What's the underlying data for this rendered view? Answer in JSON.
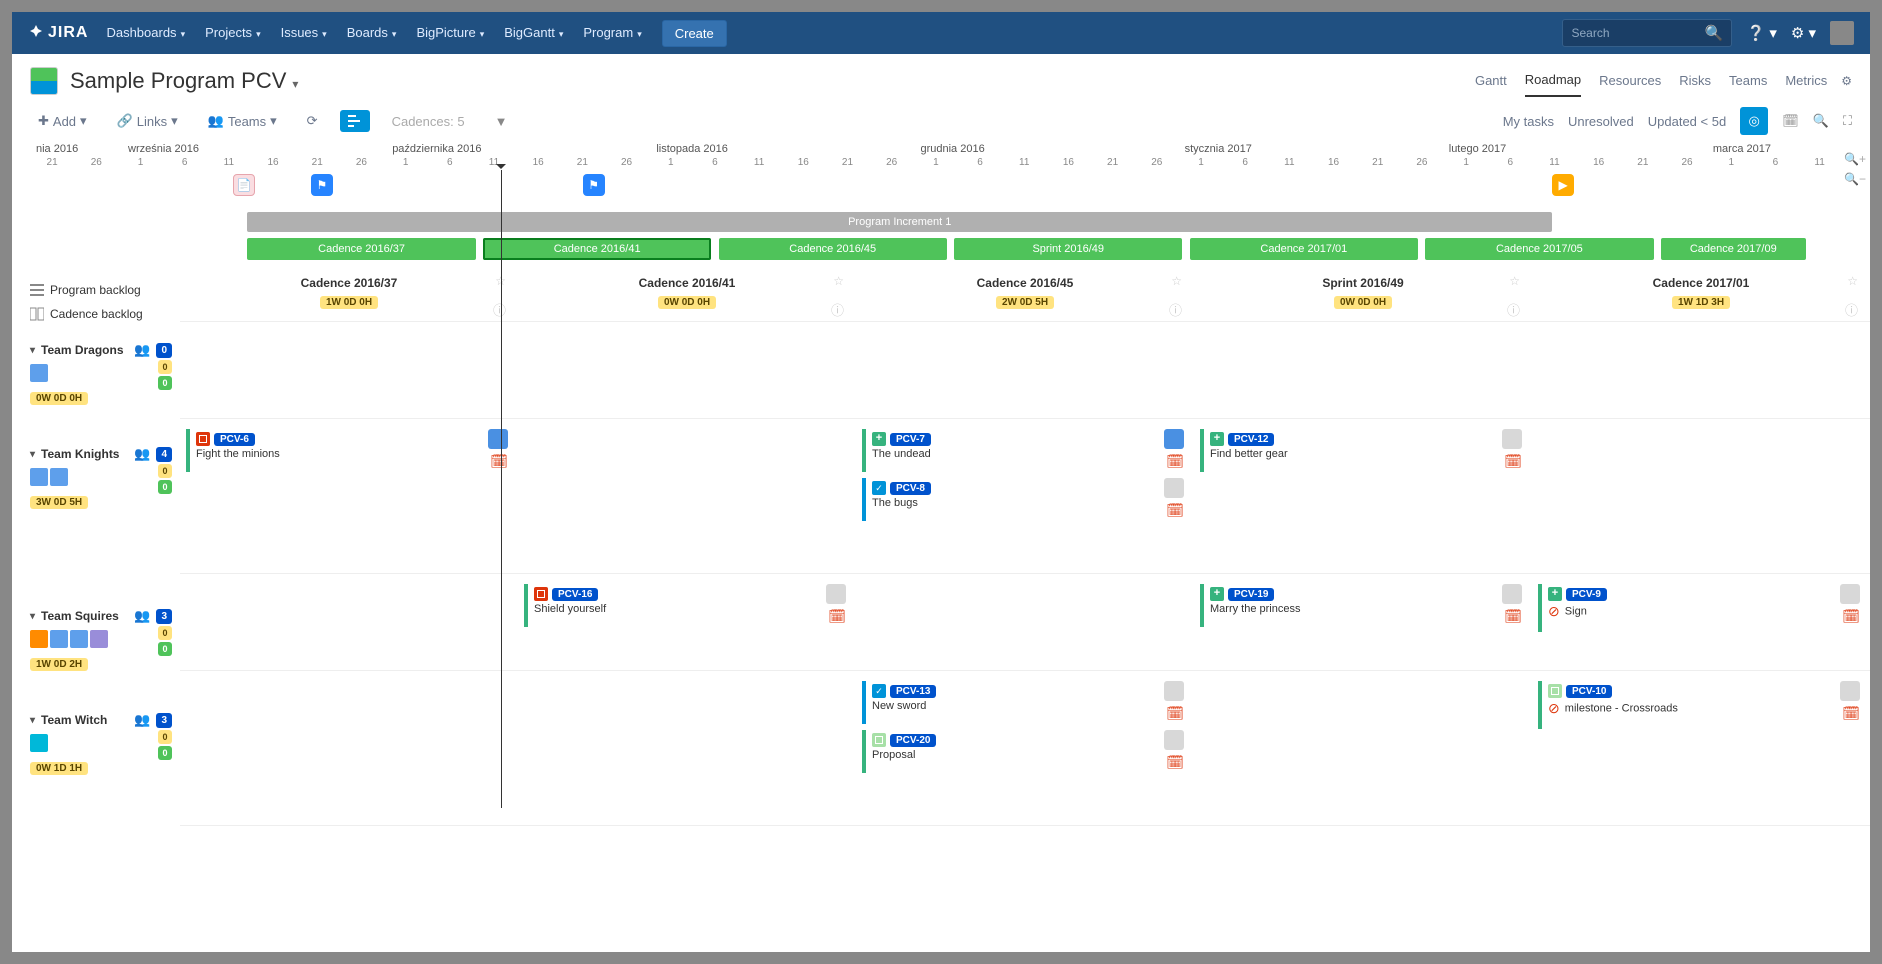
{
  "topnav": {
    "logo": "JIRA",
    "menu": [
      "Dashboards",
      "Projects",
      "Issues",
      "Boards",
      "BigPicture",
      "BigGantt",
      "Program"
    ],
    "create": "Create",
    "search_placeholder": "Search"
  },
  "header": {
    "title": "Sample Program PCV",
    "tabs": [
      "Gantt",
      "Roadmap",
      "Resources",
      "Risks",
      "Teams",
      "Metrics"
    ],
    "active_tab": "Roadmap"
  },
  "toolbar": {
    "add": "Add",
    "links": "Links",
    "teams": "Teams",
    "cadences": "Cadences: 5",
    "filters": [
      "My tasks",
      "Unresolved",
      "Updated < 5d"
    ]
  },
  "timeline": {
    "months": [
      {
        "label": "nia 2016",
        "days": [
          "21",
          "26"
        ]
      },
      {
        "label": "września 2016",
        "days": [
          "1",
          "6",
          "11",
          "16",
          "21",
          "26"
        ]
      },
      {
        "label": "października 2016",
        "days": [
          "1",
          "6",
          "11",
          "16",
          "21",
          "26"
        ]
      },
      {
        "label": "listopada 2016",
        "days": [
          "1",
          "6",
          "11",
          "16",
          "21",
          "26"
        ]
      },
      {
        "label": "grudnia 2016",
        "days": [
          "1",
          "6",
          "11",
          "16",
          "21",
          "26"
        ]
      },
      {
        "label": "stycznia 2017",
        "days": [
          "1",
          "6",
          "11",
          "16",
          "21",
          "26"
        ]
      },
      {
        "label": "lutego 2017",
        "days": [
          "1",
          "6",
          "11",
          "16",
          "21",
          "26"
        ]
      },
      {
        "label": "marca 2017",
        "days": [
          "1",
          "6",
          "11"
        ]
      }
    ],
    "increment": "Program Increment 1",
    "cadences": [
      "Cadence 2016/37",
      "Cadence 2016/41",
      "Cadence 2016/45",
      "Sprint 2016/49",
      "Cadence 2017/01",
      "Cadence 2017/05",
      "Cadence 2017/09"
    ]
  },
  "sidebar": {
    "program_backlog": "Program backlog",
    "cadence_backlog": "Cadence backlog"
  },
  "cadence_headers": [
    {
      "title": "Cadence 2016/37",
      "effort": "1W 0D 0H"
    },
    {
      "title": "Cadence 2016/41",
      "effort": "0W 0D 0H"
    },
    {
      "title": "Cadence 2016/45",
      "effort": "2W 0D 5H"
    },
    {
      "title": "Sprint 2016/49",
      "effort": "0W 0D 0H"
    },
    {
      "title": "Cadence 2017/01",
      "effort": "1W 1D 3H"
    }
  ],
  "teams": [
    {
      "name": "Team Dragons",
      "count": "0",
      "tally": [
        "0",
        "0"
      ],
      "effort": "0W 0D 0H",
      "lanes": [
        [],
        [],
        [],
        [],
        []
      ]
    },
    {
      "name": "Team Knights",
      "count": "4",
      "tally": [
        "0",
        "0"
      ],
      "effort": "3W 0D 5H",
      "lanes": [
        [
          {
            "k": "PCV-6",
            "t": "Fight the minions",
            "ic": "red",
            "asg": "b"
          }
        ],
        [],
        [
          {
            "k": "PCV-7",
            "t": "The undead",
            "ic": "green",
            "asg": "b"
          },
          {
            "k": "PCV-8",
            "t": "The bugs",
            "ic": "blue",
            "prio": true
          }
        ],
        [
          {
            "k": "PCV-12",
            "t": "Find better gear",
            "ic": "green"
          }
        ],
        []
      ]
    },
    {
      "name": "Team Squires",
      "count": "3",
      "tally": [
        "0",
        "0"
      ],
      "effort": "1W 0D 2H",
      "lanes": [
        [],
        [
          {
            "k": "PCV-16",
            "t": "Shield yourself",
            "ic": "red"
          }
        ],
        [],
        [
          {
            "k": "PCV-19",
            "t": "Marry the princess",
            "ic": "green"
          }
        ],
        [
          {
            "k": "PCV-9",
            "t": "Sign",
            "ic": "green",
            "no": true,
            "prio": true
          }
        ]
      ]
    },
    {
      "name": "Team Witch",
      "count": "3",
      "tally": [
        "0",
        "0"
      ],
      "effort": "0W 1D 1H",
      "lanes": [
        [],
        [],
        [
          {
            "k": "PCV-13",
            "t": "New sword",
            "ic": "blue"
          },
          {
            "k": "PCV-20",
            "t": "Proposal",
            "ic": "lg"
          }
        ],
        [],
        [
          {
            "k": "PCV-10",
            "t": "milestone - Crossroads",
            "ic": "lg",
            "no": true
          }
        ]
      ]
    }
  ]
}
